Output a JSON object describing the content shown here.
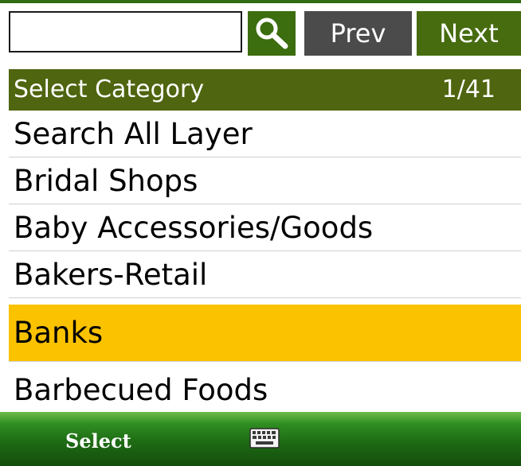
{
  "search": {
    "value": "",
    "placeholder": ""
  },
  "toolbar": {
    "prev_label": "Prev",
    "next_label": "Next"
  },
  "header": {
    "title": "Select Category",
    "count": "1/41"
  },
  "list": {
    "items": [
      {
        "label": "Search All Layer"
      },
      {
        "label": "Bridal Shops"
      },
      {
        "label": "Baby Accessories/Goods"
      },
      {
        "label": "Bakers-Retail"
      },
      {
        "label": "Banks"
      },
      {
        "label": "Barbecued Foods"
      }
    ],
    "selected_index": 4
  },
  "softkeys": {
    "left_label": "Select"
  },
  "icons": {
    "search": "search-icon",
    "keyboard": "keyboard-icon"
  },
  "colors": {
    "header_bg": "#4f650f",
    "selected_bg": "#fbc200",
    "search_btn_bg": "#3c6d0e",
    "prev_btn_bg": "#4b4b4b",
    "next_btn_bg": "#466c0f"
  }
}
